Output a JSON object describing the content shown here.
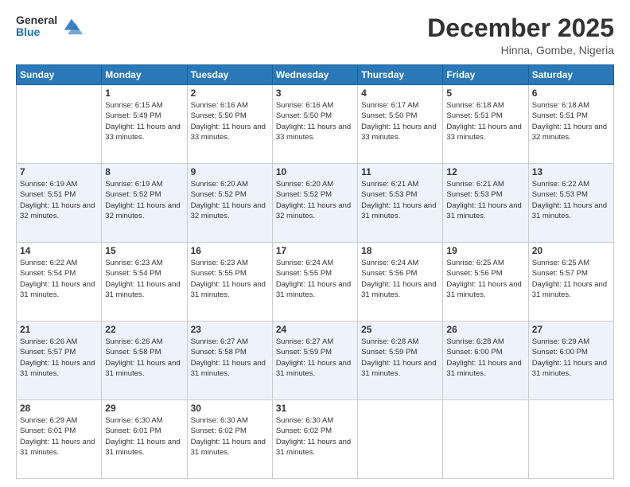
{
  "logo": {
    "general": "General",
    "blue": "Blue"
  },
  "header": {
    "month": "December 2025",
    "location": "Hinna, Gombe, Nigeria"
  },
  "weekdays": [
    "Sunday",
    "Monday",
    "Tuesday",
    "Wednesday",
    "Thursday",
    "Friday",
    "Saturday"
  ],
  "weeks": [
    [
      {
        "day": "",
        "sunrise": "",
        "sunset": "",
        "daylight": ""
      },
      {
        "day": "1",
        "sunrise": "Sunrise: 6:15 AM",
        "sunset": "Sunset: 5:49 PM",
        "daylight": "Daylight: 11 hours and 33 minutes."
      },
      {
        "day": "2",
        "sunrise": "Sunrise: 6:16 AM",
        "sunset": "Sunset: 5:50 PM",
        "daylight": "Daylight: 11 hours and 33 minutes."
      },
      {
        "day": "3",
        "sunrise": "Sunrise: 6:16 AM",
        "sunset": "Sunset: 5:50 PM",
        "daylight": "Daylight: 11 hours and 33 minutes."
      },
      {
        "day": "4",
        "sunrise": "Sunrise: 6:17 AM",
        "sunset": "Sunset: 5:50 PM",
        "daylight": "Daylight: 11 hours and 33 minutes."
      },
      {
        "day": "5",
        "sunrise": "Sunrise: 6:18 AM",
        "sunset": "Sunset: 5:51 PM",
        "daylight": "Daylight: 11 hours and 33 minutes."
      },
      {
        "day": "6",
        "sunrise": "Sunrise: 6:18 AM",
        "sunset": "Sunset: 5:51 PM",
        "daylight": "Daylight: 11 hours and 32 minutes."
      }
    ],
    [
      {
        "day": "7",
        "sunrise": "Sunrise: 6:19 AM",
        "sunset": "Sunset: 5:51 PM",
        "daylight": "Daylight: 11 hours and 32 minutes."
      },
      {
        "day": "8",
        "sunrise": "Sunrise: 6:19 AM",
        "sunset": "Sunset: 5:52 PM",
        "daylight": "Daylight: 11 hours and 32 minutes."
      },
      {
        "day": "9",
        "sunrise": "Sunrise: 6:20 AM",
        "sunset": "Sunset: 5:52 PM",
        "daylight": "Daylight: 11 hours and 32 minutes."
      },
      {
        "day": "10",
        "sunrise": "Sunrise: 6:20 AM",
        "sunset": "Sunset: 5:52 PM",
        "daylight": "Daylight: 11 hours and 32 minutes."
      },
      {
        "day": "11",
        "sunrise": "Sunrise: 6:21 AM",
        "sunset": "Sunset: 5:53 PM",
        "daylight": "Daylight: 11 hours and 31 minutes."
      },
      {
        "day": "12",
        "sunrise": "Sunrise: 6:21 AM",
        "sunset": "Sunset: 5:53 PM",
        "daylight": "Daylight: 11 hours and 31 minutes."
      },
      {
        "day": "13",
        "sunrise": "Sunrise: 6:22 AM",
        "sunset": "Sunset: 5:53 PM",
        "daylight": "Daylight: 11 hours and 31 minutes."
      }
    ],
    [
      {
        "day": "14",
        "sunrise": "Sunrise: 6:22 AM",
        "sunset": "Sunset: 5:54 PM",
        "daylight": "Daylight: 11 hours and 31 minutes."
      },
      {
        "day": "15",
        "sunrise": "Sunrise: 6:23 AM",
        "sunset": "Sunset: 5:54 PM",
        "daylight": "Daylight: 11 hours and 31 minutes."
      },
      {
        "day": "16",
        "sunrise": "Sunrise: 6:23 AM",
        "sunset": "Sunset: 5:55 PM",
        "daylight": "Daylight: 11 hours and 31 minutes."
      },
      {
        "day": "17",
        "sunrise": "Sunrise: 6:24 AM",
        "sunset": "Sunset: 5:55 PM",
        "daylight": "Daylight: 11 hours and 31 minutes."
      },
      {
        "day": "18",
        "sunrise": "Sunrise: 6:24 AM",
        "sunset": "Sunset: 5:56 PM",
        "daylight": "Daylight: 11 hours and 31 minutes."
      },
      {
        "day": "19",
        "sunrise": "Sunrise: 6:25 AM",
        "sunset": "Sunset: 5:56 PM",
        "daylight": "Daylight: 11 hours and 31 minutes."
      },
      {
        "day": "20",
        "sunrise": "Sunrise: 6:25 AM",
        "sunset": "Sunset: 5:57 PM",
        "daylight": "Daylight: 11 hours and 31 minutes."
      }
    ],
    [
      {
        "day": "21",
        "sunrise": "Sunrise: 6:26 AM",
        "sunset": "Sunset: 5:57 PM",
        "daylight": "Daylight: 11 hours and 31 minutes."
      },
      {
        "day": "22",
        "sunrise": "Sunrise: 6:26 AM",
        "sunset": "Sunset: 5:58 PM",
        "daylight": "Daylight: 11 hours and 31 minutes."
      },
      {
        "day": "23",
        "sunrise": "Sunrise: 6:27 AM",
        "sunset": "Sunset: 5:58 PM",
        "daylight": "Daylight: 11 hours and 31 minutes."
      },
      {
        "day": "24",
        "sunrise": "Sunrise: 6:27 AM",
        "sunset": "Sunset: 5:59 PM",
        "daylight": "Daylight: 11 hours and 31 minutes."
      },
      {
        "day": "25",
        "sunrise": "Sunrise: 6:28 AM",
        "sunset": "Sunset: 5:59 PM",
        "daylight": "Daylight: 11 hours and 31 minutes."
      },
      {
        "day": "26",
        "sunrise": "Sunrise: 6:28 AM",
        "sunset": "Sunset: 6:00 PM",
        "daylight": "Daylight: 11 hours and 31 minutes."
      },
      {
        "day": "27",
        "sunrise": "Sunrise: 6:29 AM",
        "sunset": "Sunset: 6:00 PM",
        "daylight": "Daylight: 11 hours and 31 minutes."
      }
    ],
    [
      {
        "day": "28",
        "sunrise": "Sunrise: 6:29 AM",
        "sunset": "Sunset: 6:01 PM",
        "daylight": "Daylight: 11 hours and 31 minutes."
      },
      {
        "day": "29",
        "sunrise": "Sunrise: 6:30 AM",
        "sunset": "Sunset: 6:01 PM",
        "daylight": "Daylight: 11 hours and 31 minutes."
      },
      {
        "day": "30",
        "sunrise": "Sunrise: 6:30 AM",
        "sunset": "Sunset: 6:02 PM",
        "daylight": "Daylight: 11 hours and 31 minutes."
      },
      {
        "day": "31",
        "sunrise": "Sunrise: 6:30 AM",
        "sunset": "Sunset: 6:02 PM",
        "daylight": "Daylight: 11 hours and 31 minutes."
      },
      {
        "day": "",
        "sunrise": "",
        "sunset": "",
        "daylight": ""
      },
      {
        "day": "",
        "sunrise": "",
        "sunset": "",
        "daylight": ""
      },
      {
        "day": "",
        "sunrise": "",
        "sunset": "",
        "daylight": ""
      }
    ]
  ]
}
